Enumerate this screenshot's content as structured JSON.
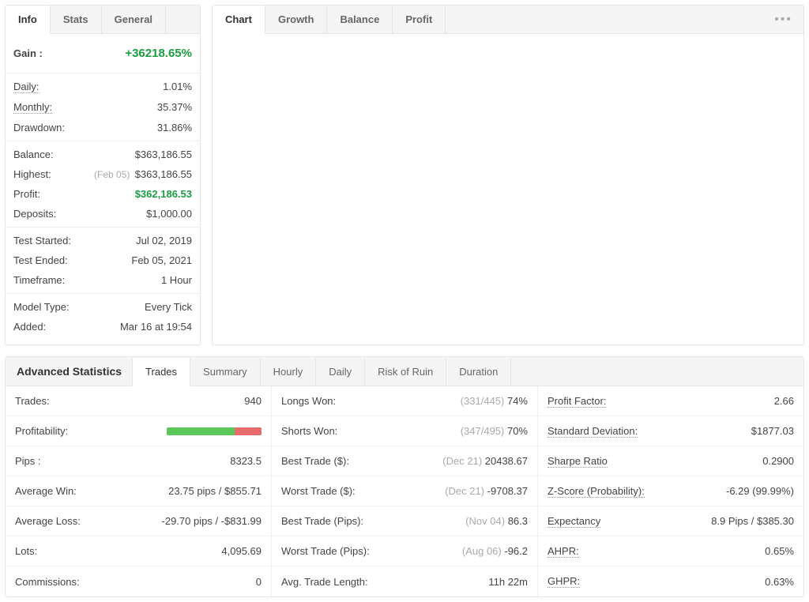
{
  "info": {
    "tabs": [
      "Info",
      "Stats",
      "General"
    ],
    "active_tab": 0,
    "gain_label": "Gain :",
    "gain_value": "+36218.65%",
    "rows1": [
      {
        "label": "Daily:",
        "value": "1.01%",
        "dotted": true
      },
      {
        "label": "Monthly:",
        "value": "35.37%",
        "dotted": true
      },
      {
        "label": "Drawdown:",
        "value": "31.86%",
        "dotted": false
      }
    ],
    "rows2": [
      {
        "label": "Balance:",
        "value": "$363,186.55"
      },
      {
        "label": "Highest:",
        "value": "$363,186.55",
        "date": "(Feb 05)"
      },
      {
        "label": "Profit:",
        "value": "$362,186.53",
        "green": true
      },
      {
        "label": "Deposits:",
        "value": "$1,000.00"
      }
    ],
    "rows3": [
      {
        "label": "Test Started:",
        "value": "Jul 02, 2019"
      },
      {
        "label": "Test Ended:",
        "value": "Feb 05, 2021"
      },
      {
        "label": "Timeframe:",
        "value": "1 Hour"
      }
    ],
    "rows4": [
      {
        "label": "Model Type:",
        "value": "Every Tick"
      },
      {
        "label": "Added:",
        "value": "Mar 16 at 19:54"
      }
    ]
  },
  "chart": {
    "tabs": [
      "Chart",
      "Growth",
      "Balance",
      "Profit"
    ],
    "active_tab": 0
  },
  "adv": {
    "title": "Advanced Statistics",
    "tabs": [
      "Trades",
      "Summary",
      "Hourly",
      "Daily",
      "Risk of Ruin",
      "Duration"
    ],
    "active_tab": 0,
    "col1": [
      {
        "label": "Trades:",
        "value": "940"
      },
      {
        "label": "Profitability:",
        "bar": {
          "green": 72,
          "red": 28
        }
      },
      {
        "label": "Pips :",
        "value": "8323.5"
      },
      {
        "label": "Average Win:",
        "value": "23.75 pips / $855.71"
      },
      {
        "label": "Average Loss:",
        "value": "-29.70 pips / -$831.99"
      },
      {
        "label": "Lots:",
        "value": "4,095.69"
      },
      {
        "label": "Commissions:",
        "value": "0"
      }
    ],
    "col2": [
      {
        "label": "Longs Won:",
        "value": "74%",
        "muted": "(331/445)"
      },
      {
        "label": "Shorts Won:",
        "value": "70%",
        "muted": "(347/495)"
      },
      {
        "label": "Best Trade ($):",
        "value": "20438.67",
        "muted": "(Dec 21)"
      },
      {
        "label": "Worst Trade ($):",
        "value": "-9708.37",
        "muted": "(Dec 21)"
      },
      {
        "label": "Best Trade (Pips):",
        "value": "86.3",
        "muted": "(Nov 04)"
      },
      {
        "label": "Worst Trade (Pips):",
        "value": "-96.2",
        "muted": "(Aug 06)"
      },
      {
        "label": "Avg. Trade Length:",
        "value": "11h 22m"
      }
    ],
    "col3": [
      {
        "label": "Profit Factor:",
        "value": "2.66",
        "dotted": true
      },
      {
        "label": "Standard Deviation:",
        "value": "$1877.03",
        "dotted": true
      },
      {
        "label": "Sharpe Ratio",
        "value": "0.2900",
        "dotted": true
      },
      {
        "label": "Z-Score (Probability):",
        "value": "-6.29 (99.99%)",
        "dotted": true
      },
      {
        "label": "Expectancy",
        "value": "8.9 Pips / $385.30",
        "dotted": true
      },
      {
        "label": "AHPR:",
        "value": "0.65%",
        "dotted": true
      },
      {
        "label": "GHPR:",
        "value": "0.63%",
        "dotted": true
      }
    ]
  }
}
